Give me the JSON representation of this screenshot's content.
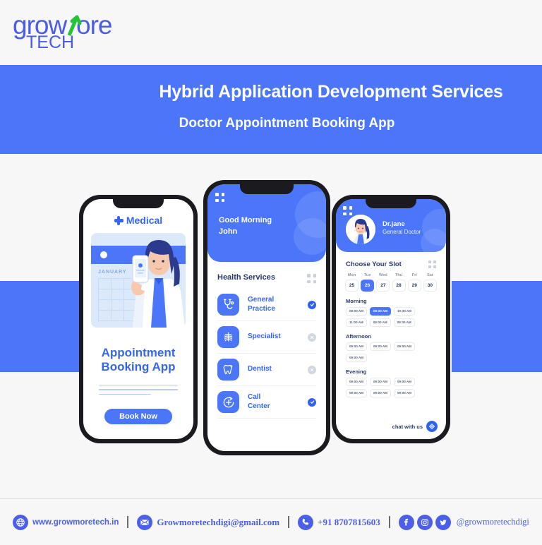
{
  "brand": {
    "logo_part1": "grow",
    "logo_part2": "more",
    "logo_sub": "TECH",
    "logo_color": "#4a5ce8",
    "arrow_color": "#24c43a"
  },
  "banner": {
    "title": "Hybrid Application Development Services",
    "subtitle": "Doctor Appointment Booking App",
    "bg_color": "#4b76fa"
  },
  "phone_left": {
    "header": "Medical",
    "header_icon": "medical-cross-icon",
    "calendar_month": "JANUARY",
    "title_line1": "Appointment",
    "title_line2": "Booking App",
    "button_label": "Book Now"
  },
  "phone_center": {
    "greeting_line1": "Good Morning",
    "greeting_line2": "John",
    "section_title": "Health Services",
    "services": [
      {
        "label_line1": "General",
        "label_line2": "Practice",
        "icon": "stethoscope-icon",
        "status": "selected"
      },
      {
        "label_line1": "Specialist",
        "label_line2": "",
        "icon": "ribcage-xray-icon",
        "status": "unselected"
      },
      {
        "label_line1": "Dentist",
        "label_line2": "",
        "icon": "tooth-icon",
        "status": "unselected"
      },
      {
        "label_line1": "Call",
        "label_line2": "Center",
        "icon": "emergency-cross-icon",
        "status": "selected"
      }
    ]
  },
  "phone_right": {
    "doctor_name": "Dr.jane",
    "doctor_role": "General Doctor",
    "slot_title": "Choose Your Slot",
    "days": [
      {
        "name": "Mon",
        "num": "25",
        "selected": false
      },
      {
        "name": "Tue",
        "num": "26",
        "selected": true
      },
      {
        "name": "Wed",
        "num": "27",
        "selected": false
      },
      {
        "name": "Thu",
        "num": "28",
        "selected": false
      },
      {
        "name": "Fri",
        "num": "29",
        "selected": false
      },
      {
        "name": "Sat",
        "num": "30",
        "selected": false
      }
    ],
    "periods": [
      {
        "label": "Morning",
        "slots": [
          {
            "time": "09:00 AM",
            "selected": false
          },
          {
            "time": "09:30 AM",
            "selected": true
          },
          {
            "time": "10:30 AM",
            "selected": false
          },
          {
            "time": "11:00 AM",
            "selected": false
          },
          {
            "time": "09:00 AM",
            "selected": false
          },
          {
            "time": "09:30 AM",
            "selected": false
          }
        ]
      },
      {
        "label": "Afternoon",
        "slots": [
          {
            "time": "09:00 AM",
            "selected": false
          },
          {
            "time": "09:00 AM",
            "selected": false
          },
          {
            "time": "09:00 AM",
            "selected": false
          },
          {
            "time": "09:00 AM",
            "selected": false
          }
        ]
      },
      {
        "label": "Evening",
        "slots": [
          {
            "time": "09:00 AM",
            "selected": false
          },
          {
            "time": "09:00 AM",
            "selected": false
          },
          {
            "time": "09:00 AM",
            "selected": false
          },
          {
            "time": "09:00 AM",
            "selected": false
          },
          {
            "time": "09:00 AM",
            "selected": false
          },
          {
            "time": "09:00 AM",
            "selected": false
          }
        ]
      }
    ],
    "chat_label": "chat with us",
    "chat_icon": "diamond-arrows-icon"
  },
  "footer": {
    "website": "www.growmoretech.in",
    "email": "Growmoretechdigi@gmail.com",
    "phone": "+91 8707815603",
    "handle": "@growmoretechdigi",
    "social": [
      "facebook-icon",
      "instagram-icon",
      "twitter-icon"
    ],
    "accent_color": "#4b5fe8"
  }
}
